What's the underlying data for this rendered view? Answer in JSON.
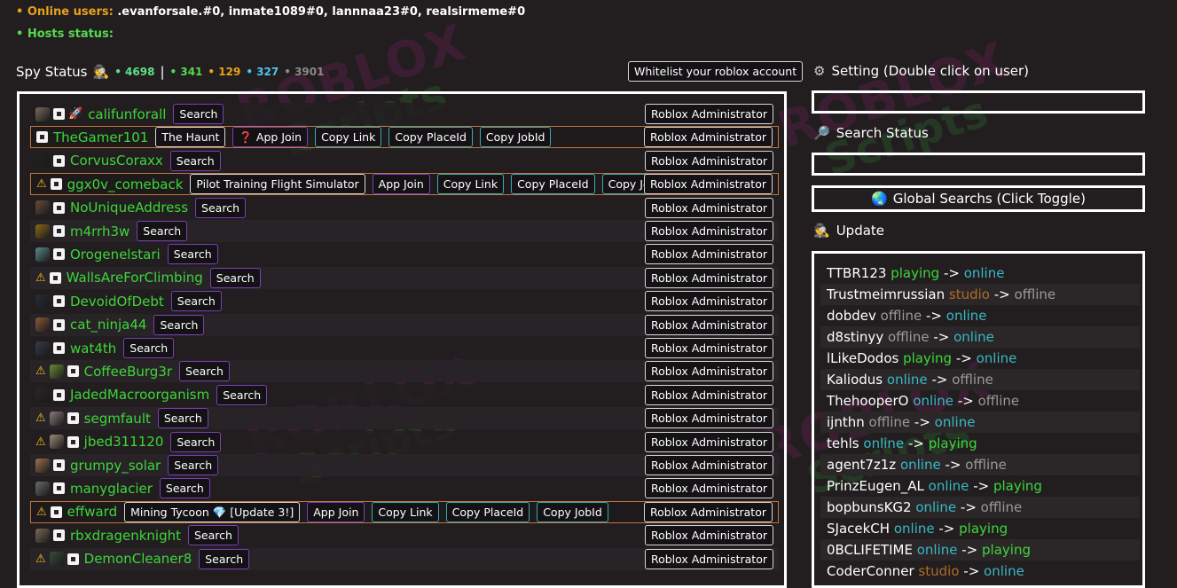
{
  "header": {
    "online_label": "• Online users:",
    "online_users": ".evanforsale.#0, inmate1089#0, lannnaa23#0, realsirmeme#0",
    "hosts_label": "• Hosts status:"
  },
  "spy": {
    "title": "Spy Status",
    "icon": "spy-icon",
    "count_total": "• 4698",
    "sep": "|",
    "count_green": "• 341",
    "count_orange": "• 129",
    "count_blue": "• 327",
    "count_gray": "• 3901",
    "colors": {
      "green": "#53d94d",
      "orange": "#e8a21a",
      "blue": "#49c5ee",
      "gray": "#8a8a8a",
      "total": "#5fe08a"
    },
    "whitelist_button": "Whitelist your roblox account"
  },
  "rows": [
    {
      "name": "califunforall",
      "warn": false,
      "avatar": "#7a6a5a",
      "icon2": "rocket-icon",
      "buttons": [
        {
          "label": "Search",
          "style": "purple"
        }
      ],
      "admin": "Roblox Administrator",
      "highlight": false
    },
    {
      "name": "TheGamer101",
      "warn": false,
      "avatar": null,
      "buttons": [
        {
          "label": "The Haunt",
          "style": "white"
        },
        {
          "label": "❓ App Join",
          "style": "purple"
        },
        {
          "label": "Copy Link",
          "style": "teal"
        },
        {
          "label": "Copy PlaceId",
          "style": "teal"
        },
        {
          "label": "Copy JobId",
          "style": "teal"
        }
      ],
      "admin": "Roblox Administrator",
      "highlight": true
    },
    {
      "name": "CorvusCoraxx",
      "warn": false,
      "avatar": "#222",
      "buttons": [
        {
          "label": "Search",
          "style": "purple"
        }
      ],
      "admin": "Roblox Administrator",
      "highlight": false
    },
    {
      "name": "ggx0v_comeback",
      "warn": true,
      "avatar": null,
      "buttons": [
        {
          "label": "Pilot Training Flight Simulator",
          "style": "white"
        },
        {
          "label": "App Join",
          "style": "purple"
        },
        {
          "label": "Copy Link",
          "style": "teal"
        },
        {
          "label": "Copy PlaceId",
          "style": "teal"
        },
        {
          "label": "Copy JobId",
          "style": "teal"
        }
      ],
      "admin": "Roblox Administrator",
      "highlight": true
    },
    {
      "name": "NoUniqueAddress",
      "warn": false,
      "avatar": "#6b4a3a",
      "buttons": [
        {
          "label": "Search",
          "style": "purple"
        }
      ],
      "admin": "Roblox Administrator",
      "highlight": false
    },
    {
      "name": "m4rrh3w",
      "warn": false,
      "avatar": "#8a6a1a",
      "buttons": [
        {
          "label": "Search",
          "style": "purple"
        }
      ],
      "admin": "Roblox Administrator",
      "highlight": false
    },
    {
      "name": "Orogenelstari",
      "warn": false,
      "avatar": "#5a8a8a",
      "buttons": [
        {
          "label": "Search",
          "style": "purple"
        }
      ],
      "admin": "Roblox Administrator",
      "highlight": false
    },
    {
      "name": "WallsAreForClimbing",
      "warn": true,
      "avatar": null,
      "buttons": [
        {
          "label": "Search",
          "style": "purple"
        }
      ],
      "admin": "Roblox Administrator",
      "highlight": false
    },
    {
      "name": "DevoidOfDebt",
      "warn": false,
      "avatar": "#2a2a3a",
      "buttons": [
        {
          "label": "Search",
          "style": "purple"
        }
      ],
      "admin": "Roblox Administrator",
      "highlight": false
    },
    {
      "name": "cat_ninja44",
      "warn": false,
      "avatar": "#8a5a3a",
      "buttons": [
        {
          "label": "Search",
          "style": "purple"
        }
      ],
      "admin": "Roblox Administrator",
      "highlight": false
    },
    {
      "name": "wat4th",
      "warn": false,
      "avatar": "#3a3a4a",
      "buttons": [
        {
          "label": "Search",
          "style": "purple"
        }
      ],
      "admin": "Roblox Administrator",
      "highlight": false
    },
    {
      "name": "CoffeeBurg3r",
      "warn": true,
      "avatar": "#6a8a3a",
      "buttons": [
        {
          "label": "Search",
          "style": "purple"
        }
      ],
      "admin": "Roblox Administrator",
      "highlight": false
    },
    {
      "name": "JadedMacroorganism",
      "warn": false,
      "avatar": "#2a2628",
      "buttons": [
        {
          "label": "Search",
          "style": "purple"
        }
      ],
      "admin": "Roblox Administrator",
      "highlight": false
    },
    {
      "name": "segmfault",
      "warn": true,
      "avatar": "#8a7a7a",
      "buttons": [
        {
          "label": "Search",
          "style": "purple"
        }
      ],
      "admin": "Roblox Administrator",
      "highlight": false
    },
    {
      "name": "jbed311120",
      "warn": true,
      "avatar": "#9a8a7a",
      "buttons": [
        {
          "label": "Search",
          "style": "purple"
        }
      ],
      "admin": "Roblox Administrator",
      "highlight": false
    },
    {
      "name": "grumpy_solar",
      "warn": false,
      "avatar": "#a07050",
      "buttons": [
        {
          "label": "Search",
          "style": "purple"
        }
      ],
      "admin": "Roblox Administrator",
      "highlight": false
    },
    {
      "name": "manyglacier",
      "warn": false,
      "avatar": "#6a6a6a",
      "buttons": [
        {
          "label": "Search",
          "style": "purple"
        }
      ],
      "admin": "Roblox Administrator",
      "highlight": false
    },
    {
      "name": "effward",
      "warn": true,
      "avatar": null,
      "buttons": [
        {
          "label": "Mining Tycoon 💎 [Update 3!]",
          "style": "white"
        },
        {
          "label": "App Join",
          "style": "purple"
        },
        {
          "label": "Copy Link",
          "style": "teal"
        },
        {
          "label": "Copy PlaceId",
          "style": "teal"
        },
        {
          "label": "Copy JobId",
          "style": "teal"
        }
      ],
      "admin": "Roblox Administrator",
      "highlight": true
    },
    {
      "name": "rbxdragenknight",
      "warn": false,
      "avatar": "#7a6a5a",
      "buttons": [
        {
          "label": "Search",
          "style": "purple"
        }
      ],
      "admin": "Roblox Administrator",
      "highlight": false
    },
    {
      "name": "DemonCleaner8",
      "warn": true,
      "avatar": "#3a4a3a",
      "buttons": [
        {
          "label": "Search",
          "style": "purple"
        }
      ],
      "admin": "Roblox Administrator",
      "highlight": false
    }
  ],
  "settings": {
    "icon": "gear-icon",
    "title": "Setting (Double click on user)"
  },
  "search_status": {
    "icon": "magnifier-icon",
    "title": "Search Status"
  },
  "global": {
    "icon": "globe-icon",
    "label": "Global Searchs (Click Toggle)"
  },
  "update": {
    "icon": "spy-icon",
    "title": "Update",
    "entries": [
      {
        "user": "TTBR123",
        "from": "playing",
        "to": "online"
      },
      {
        "user": "Trustmeimrussian",
        "from": "studio",
        "to": "offline"
      },
      {
        "user": "dobdev",
        "from": "offline",
        "to": "online"
      },
      {
        "user": "d8stinyy",
        "from": "offline",
        "to": "online"
      },
      {
        "user": "lLikeDodos",
        "from": "playing",
        "to": "online"
      },
      {
        "user": "Kaliodus",
        "from": "online",
        "to": "offline"
      },
      {
        "user": "ThehooperO",
        "from": "online",
        "to": "offline"
      },
      {
        "user": "ijnthn",
        "from": "offline",
        "to": "online"
      },
      {
        "user": "tehls",
        "from": "online",
        "to": "playing"
      },
      {
        "user": "agent7z1z",
        "from": "online",
        "to": "offline"
      },
      {
        "user": "PrinzEugen_AL",
        "from": "online",
        "to": "playing"
      },
      {
        "user": "bopbunsKG2",
        "from": "online",
        "to": "offline"
      },
      {
        "user": "SJacekCH",
        "from": "online",
        "to": "playing"
      },
      {
        "user": "0BCLIFETIME",
        "from": "online",
        "to": "playing"
      },
      {
        "user": "CoderConner",
        "from": "studio",
        "to": "online"
      }
    ],
    "arrow": "->"
  },
  "watermark": {
    "line1": "ROBLOX",
    "line2": "Scripts",
    "line3": ".com"
  }
}
